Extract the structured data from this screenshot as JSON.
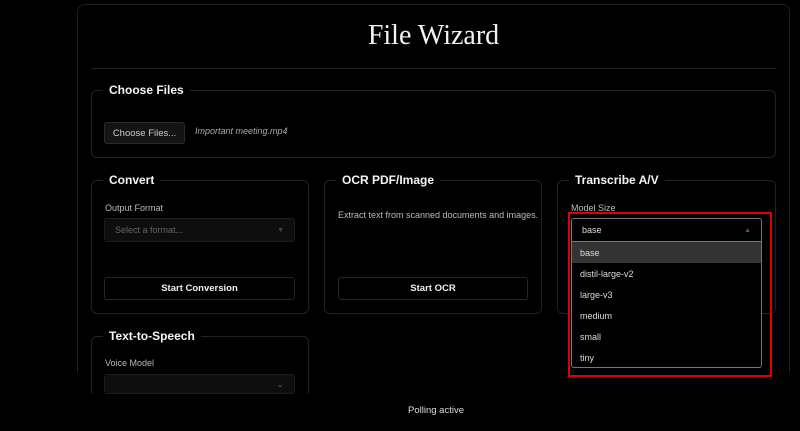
{
  "header": {
    "title": "File Wizard"
  },
  "choose_files": {
    "legend": "Choose Files",
    "button_label": "Choose Files...",
    "selected_file": "Important meeting.mp4"
  },
  "convert": {
    "legend": "Convert",
    "label": "Output Format",
    "placeholder": "Select a format...",
    "button_label": "Start Conversion"
  },
  "ocr": {
    "legend": "OCR PDF/Image",
    "description": "Extract text from scanned documents and images.",
    "button_label": "Start OCR"
  },
  "transcribe": {
    "legend": "Transcribe A/V",
    "label": "Model Size",
    "selected": "base",
    "options": [
      "base",
      "distil-large-v2",
      "large-v3",
      "medium",
      "small",
      "tiny"
    ]
  },
  "tts": {
    "legend": "Text-to-Speech",
    "label": "Voice Model",
    "selected": ""
  },
  "status": "Polling active",
  "colors": {
    "highlight": "#e00000",
    "background": "#000000"
  }
}
